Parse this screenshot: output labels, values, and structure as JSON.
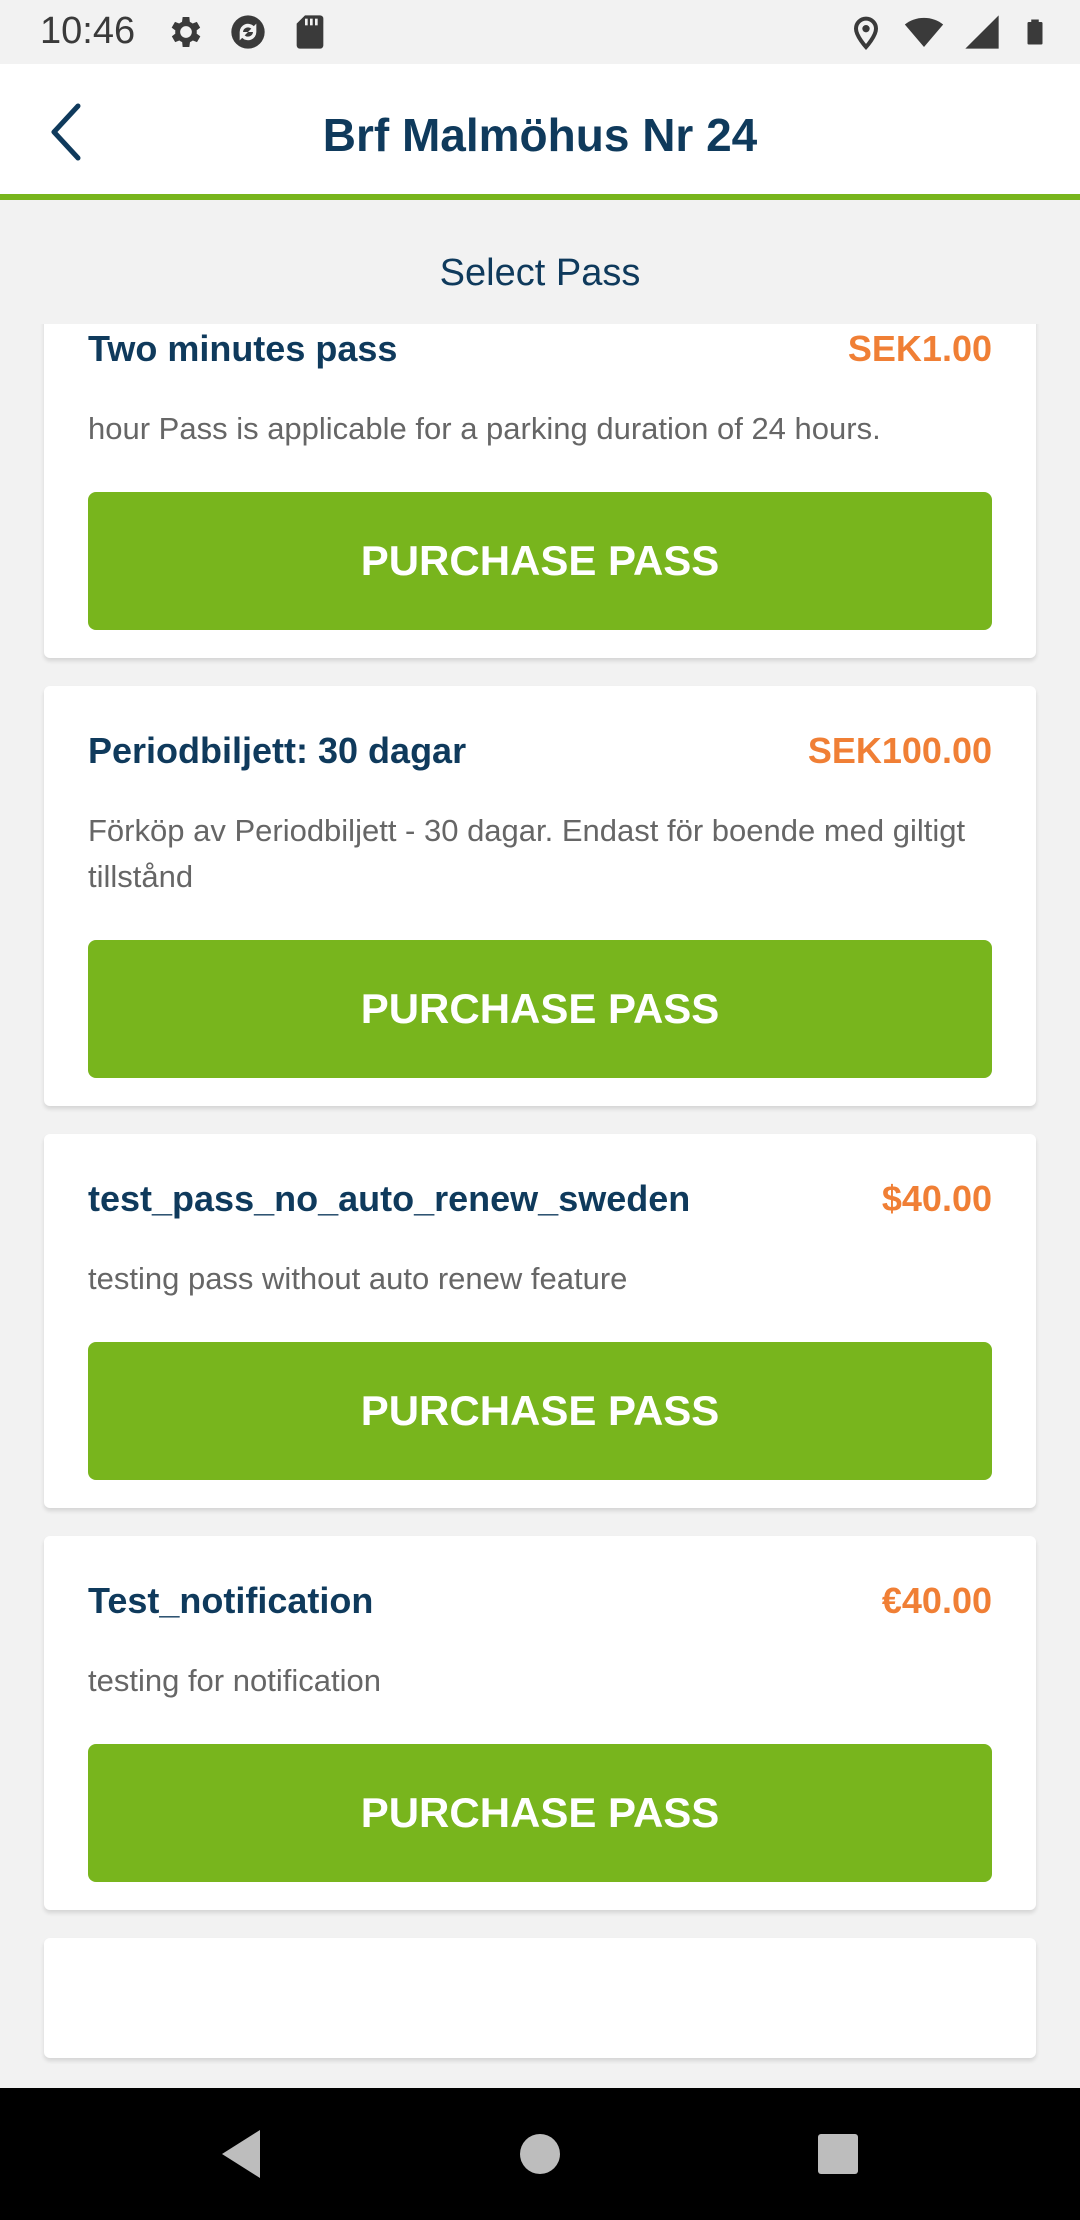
{
  "status_bar": {
    "time": "10:46",
    "left_icons": [
      "settings-icon",
      "sync-icon",
      "sd-card-icon"
    ],
    "right_icons": [
      "location-icon",
      "wifi-icon",
      "signal-icon",
      "battery-icon"
    ]
  },
  "app_bar": {
    "back_icon": "back-arrow-icon",
    "title": "Brf Malmöhus Nr 24"
  },
  "section_title": "Select Pass",
  "passes": [
    {
      "name": "Two minutes pass",
      "price": "SEK1.00",
      "description": "hour Pass is applicable for a parking duration of 24 hours.",
      "button_label": "PURCHASE PASS"
    },
    {
      "name": "Periodbiljett: 30 dagar",
      "price": "SEK100.00",
      "description": "Förköp av Periodbiljett - 30 dagar. Endast för boende med giltigt tillstånd",
      "button_label": "PURCHASE PASS"
    },
    {
      "name": "test_pass_no_auto_renew_sweden",
      "price": "$40.00",
      "description": "testing pass without auto renew feature",
      "button_label": "PURCHASE PASS"
    },
    {
      "name": "Test_notification",
      "price": "€40.00",
      "description": "testing for notification",
      "button_label": "PURCHASE PASS"
    }
  ],
  "colors": {
    "primary_text": "#0f3a5c",
    "price": "#f07f35",
    "accent_green": "#78b51d",
    "background": "#f2f2f2"
  },
  "nav_bar": {
    "icons": [
      "nav-back-icon",
      "nav-home-icon",
      "nav-recents-icon"
    ]
  }
}
